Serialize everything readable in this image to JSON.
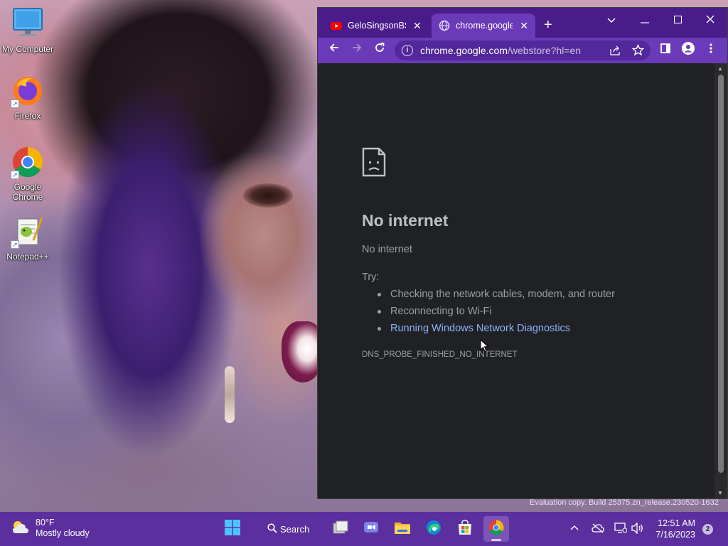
{
  "desktop": {
    "icons": [
      {
        "label": "My Computer",
        "icon": "monitor-icon"
      },
      {
        "label": "Firefox",
        "icon": "firefox-icon"
      },
      {
        "label": "Google Chrome",
        "icon": "chrome-icon"
      },
      {
        "label": "Notepad++",
        "icon": "notepadpp-icon"
      }
    ],
    "watermark": "Evaluation copy. Build 25375.zn_release.230520-1632"
  },
  "browser": {
    "tabs": [
      {
        "title": "GeloSingsonBSC",
        "favicon": "youtube-icon",
        "active": false
      },
      {
        "title": "chrome.google.",
        "favicon": "globe-icon",
        "active": true
      }
    ],
    "new_tab_label": "+",
    "url_host": "chrome.google.com",
    "url_path": "/webstore?hl=en",
    "accent_color": "#6a3ab8",
    "page": {
      "title": "No internet",
      "subtitle": "No internet",
      "try_label": "Try:",
      "suggestions": [
        "Checking the network cables, modem, and router",
        "Reconnecting to Wi-Fi",
        "Running Windows Network Diagnostics"
      ],
      "error_code": "DNS_PROBE_FINISHED_NO_INTERNET"
    }
  },
  "taskbar": {
    "weather_temp": "80°F",
    "weather_desc": "Mostly cloudy",
    "search_label": "Search",
    "time": "12:51 AM",
    "date": "7/16/2023",
    "notification_count": "2"
  }
}
